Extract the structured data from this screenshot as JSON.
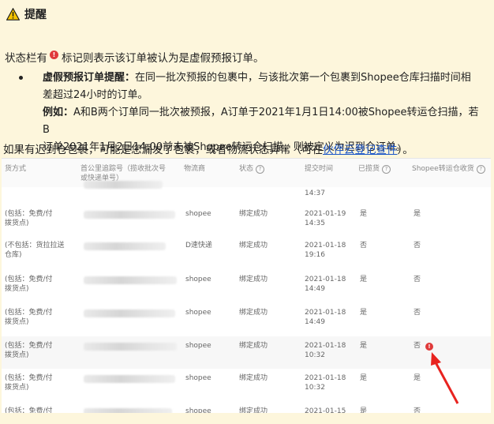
{
  "header": {
    "icon": "warning-icon",
    "title": "提醒"
  },
  "status_line": {
    "before": "状态栏有",
    "after": "标记则表示该订单被认为是虚假预报订单。"
  },
  "bullet": {
    "heading": "虚假预报订单提醒：",
    "text_line1": "在同一批次预报的包裹中，与该批次第一个包裹到Shopee仓库扫描时间相",
    "text_line2": "差超过24小时的订单。",
    "example_label": "例如：",
    "example_line1": "A和B两个订单同一批次被预报，A订单于2021年1月1日14:00被Shopee转运仓扫描，若B",
    "example_line2": "订单2021年1月2日14:00前未被Shopee转运仓扫描，则被定义为迟到仓订单。"
  },
  "tail": {
    "before": "如果有迟到仓包裹，可能是您漏发了包裹，或者物流状态异常（可在",
    "link": "伙伴云登记查件",
    "after": "）。"
  },
  "table": {
    "headers": {
      "method": "货方式",
      "tracking_l1": "首公里追踪号（揽收批次号",
      "tracking_l2": "或快递单号）",
      "carrier": "物流商",
      "status": "状态",
      "submit_time": "提交时间",
      "picked": "已揽货",
      "scanned": "Shopee转运仓收货"
    },
    "rows": [
      {
        "method": [
          "",
          ""
        ],
        "carrier": "",
        "status": "",
        "date": "",
        "time": "14:37",
        "picked": "",
        "scanned": "",
        "flag": false
      },
      {
        "method": [
          "(包括：免费/付",
          "拨货点)"
        ],
        "carrier": "shopee",
        "status": "绑定成功",
        "date": "2021-01-19",
        "time": "14:35",
        "picked": "是",
        "scanned": "是",
        "flag": false
      },
      {
        "method": [
          "(不包括：货拉拉送",
          "仓库)"
        ],
        "carrier": "D速快递",
        "status": "绑定成功",
        "date": "2021-01-18",
        "time": "19:16",
        "picked": "否",
        "scanned": "否",
        "flag": false
      },
      {
        "method": [
          "(包括：免费/付",
          "拨货点)"
        ],
        "carrier": "shopee",
        "status": "绑定成功",
        "date": "2021-01-18",
        "time": "14:49",
        "picked": "是",
        "scanned": "否",
        "flag": false
      },
      {
        "method": [
          "(包括：免费/付",
          "拨货点)"
        ],
        "carrier": "shopee",
        "status": "绑定成功",
        "date": "2021-01-18",
        "time": "14:49",
        "picked": "是",
        "scanned": "否",
        "flag": false
      },
      {
        "method": [
          "(包括：免费/付",
          "拨货点)"
        ],
        "carrier": "shopee",
        "status": "绑定成功",
        "date": "2021-01-18",
        "time": "10:32",
        "picked": "是",
        "scanned": "否",
        "flag": true
      },
      {
        "method": [
          "(包括：免费/付",
          "拨货点)"
        ],
        "carrier": "shopee",
        "status": "绑定成功",
        "date": "2021-01-18",
        "time": "10:32",
        "picked": "是",
        "scanned": "是",
        "flag": false
      },
      {
        "method": [
          "(包括：免费/付",
          ""
        ],
        "carrier": "shopee",
        "status": "绑定成功",
        "date": "2021-01-15",
        "time": "",
        "picked": "是",
        "scanned": "否",
        "flag": false
      }
    ]
  },
  "colors": {
    "background": "#fdf6dc",
    "alert_red": "#e03a3a",
    "link": "#1a55c8"
  }
}
